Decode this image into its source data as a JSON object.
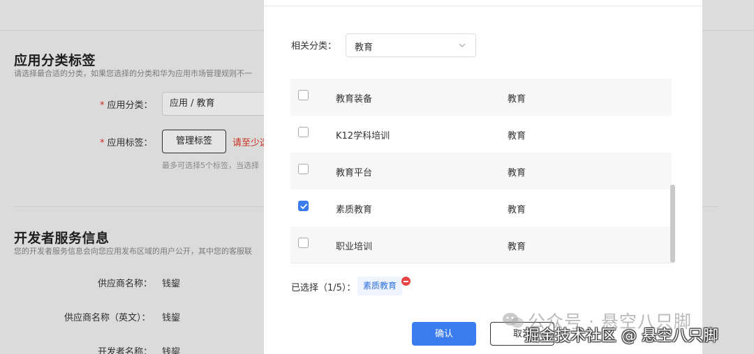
{
  "background": {
    "section1": {
      "title": "应用分类标签",
      "desc": "请选择最合适的分类，如果您选择的分类和华为应用市场管理规则不一",
      "category_label": "应用分类：",
      "category_value": "应用 / 教育",
      "tags_label": "应用标签：",
      "manage_tags_button": "管理标签",
      "warning": "请至少选",
      "hint": "最多可选择5个标签，当选择"
    },
    "section2": {
      "title": "开发者服务信息",
      "desc": "您的开发者服务信息会向您应用发布区域的用户公开，其中您的客服联",
      "fields": [
        {
          "label": "供应商名称：",
          "value": "钱鋆"
        },
        {
          "label": "供应商名称（英文）：",
          "value": "钱鋆"
        },
        {
          "label": "开发者名称：",
          "value": "钱鋆"
        }
      ]
    }
  },
  "modal": {
    "filter_label": "相关分类：",
    "filter_value": "教育",
    "rows": [
      {
        "name": "教育装备",
        "category": "教育",
        "checked": false
      },
      {
        "name": "K12学科培训",
        "category": "教育",
        "checked": false
      },
      {
        "name": "教育平台",
        "category": "教育",
        "checked": false
      },
      {
        "name": "素质教育",
        "category": "教育",
        "checked": true
      },
      {
        "name": "职业培训",
        "category": "教育",
        "checked": false
      }
    ],
    "selected_label": "已选择（1/5）：",
    "selected_tags": [
      "素质教育"
    ],
    "confirm_button": "确认",
    "cancel_button": "取消"
  },
  "watermarks": {
    "wechat": "公众号 · 悬空八只脚",
    "juejin": "掘金技术社区 @ 悬空八只脚"
  },
  "colors": {
    "primary": "#3a7cf0",
    "danger": "#e0301e"
  }
}
